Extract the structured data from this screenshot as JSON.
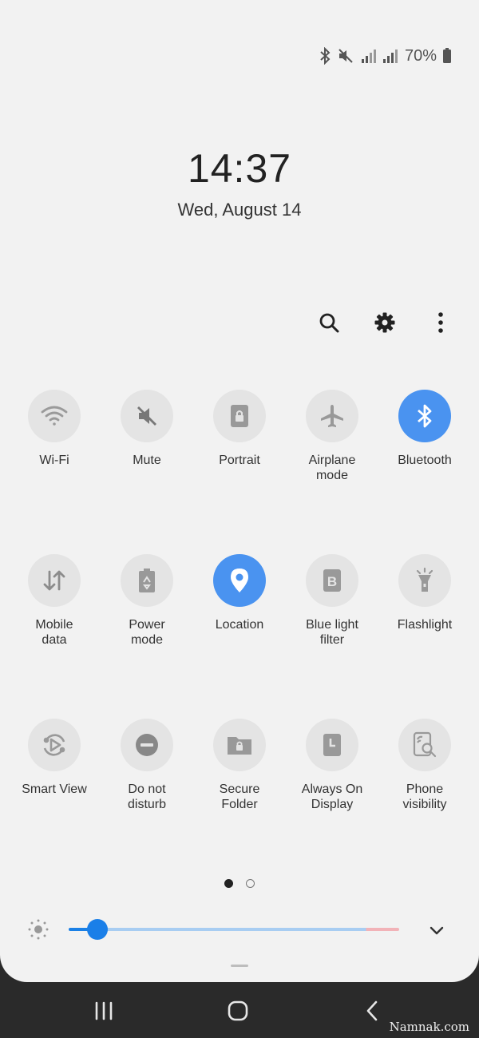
{
  "status_bar": {
    "icons": [
      "bluetooth-icon",
      "mute-icon",
      "signal-icon",
      "signal-icon",
      "battery-icon"
    ],
    "battery_percent": "70%"
  },
  "lockscreen": {
    "time": "14:37",
    "date": "Wed, August 14"
  },
  "toolbar": {
    "icons": [
      "search-icon",
      "settings-icon",
      "more-options-icon"
    ]
  },
  "quick_settings": {
    "tiles": [
      {
        "label": "Wi-Fi",
        "icon": "wifi-icon",
        "active": false
      },
      {
        "label": "Mute",
        "icon": "mute-icon",
        "active": false
      },
      {
        "label": "Portrait",
        "icon": "portrait-lock-icon",
        "active": false
      },
      {
        "label": "Airplane\nmode",
        "icon": "airplane-icon",
        "active": false
      },
      {
        "label": "Bluetooth",
        "icon": "bluetooth-icon",
        "active": true
      },
      {
        "label": "Mobile\ndata",
        "icon": "mobile-data-icon",
        "active": false
      },
      {
        "label": "Power\nmode",
        "icon": "power-mode-icon",
        "active": false
      },
      {
        "label": "Location",
        "icon": "location-icon",
        "active": true
      },
      {
        "label": "Blue light\nfilter",
        "icon": "blue-light-filter-icon",
        "active": false
      },
      {
        "label": "Flashlight",
        "icon": "flashlight-icon",
        "active": false
      },
      {
        "label": "Smart View",
        "icon": "smart-view-icon",
        "active": false
      },
      {
        "label": "Do not\ndisturb",
        "icon": "do-not-disturb-icon",
        "active": false
      },
      {
        "label": "Secure\nFolder",
        "icon": "secure-folder-icon",
        "active": false
      },
      {
        "label": "Always On\nDisplay",
        "icon": "always-on-display-icon",
        "active": false
      },
      {
        "label": "Phone\nvisibility",
        "icon": "phone-visibility-icon",
        "active": false
      }
    ]
  },
  "pagination": {
    "current_page": 1,
    "total_pages": 2
  },
  "brightness": {
    "level": 0.08,
    "accent_color": "#1a7fe8"
  },
  "colors": {
    "active_tile": "#4a93f0",
    "inactive_tile": "#e4e4e4",
    "panel": "#f2f2f2",
    "nav_bar": "#2a2a2a"
  },
  "navigation": {
    "icons": [
      "recent-apps-icon",
      "home-icon",
      "back-icon"
    ]
  },
  "watermark": "Namnak.com"
}
